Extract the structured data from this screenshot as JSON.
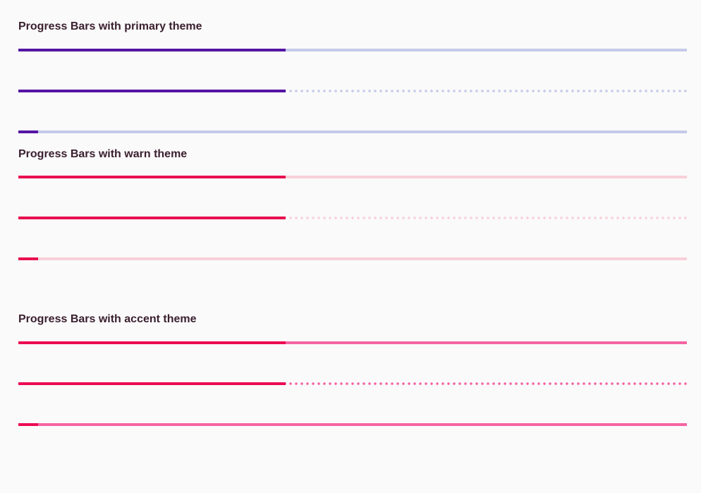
{
  "sections": [
    {
      "title": "Progress Bars with primary theme",
      "fill_color": "#5515a3",
      "track_color": "#c5cae9",
      "bars": [
        {
          "mode": "determinate",
          "value": 40
        },
        {
          "mode": "buffer",
          "value": 40
        },
        {
          "mode": "indeterminate",
          "value": 3
        }
      ]
    },
    {
      "title": "Progress Bars with warn theme",
      "fill_color": "#e8104f",
      "track_color": "#f8cfd9",
      "bars": [
        {
          "mode": "determinate",
          "value": 40
        },
        {
          "mode": "buffer",
          "value": 40
        },
        {
          "mode": "indeterminate",
          "value": 3
        }
      ]
    },
    {
      "title": "Progress Bars with accent theme",
      "fill_color": "#ec0b52",
      "track_color": "#f564a3",
      "bars": [
        {
          "mode": "determinate",
          "value": 40
        },
        {
          "mode": "buffer",
          "value": 40
        },
        {
          "mode": "indeterminate",
          "value": 3
        }
      ]
    }
  ]
}
